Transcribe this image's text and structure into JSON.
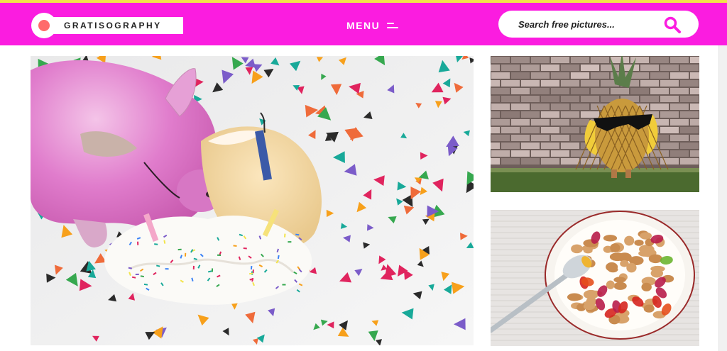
{
  "brand": {
    "logo_text": "GRATISOGRAPHY",
    "header_color": "#fb1ce0",
    "top_line_color": "#f2e44a"
  },
  "nav": {
    "menu_label": "MENU",
    "menu_icon": "hamburger-icon"
  },
  "search": {
    "placeholder": "Search free pictures...",
    "icon": "search-icon",
    "icon_color": "#fb1ce0"
  },
  "gallery": [
    {
      "subject": "pig-eating-cake"
    },
    {
      "subject": "pineapple-with-sunglasses"
    },
    {
      "subject": "gummy-bears-in-cereal"
    }
  ]
}
